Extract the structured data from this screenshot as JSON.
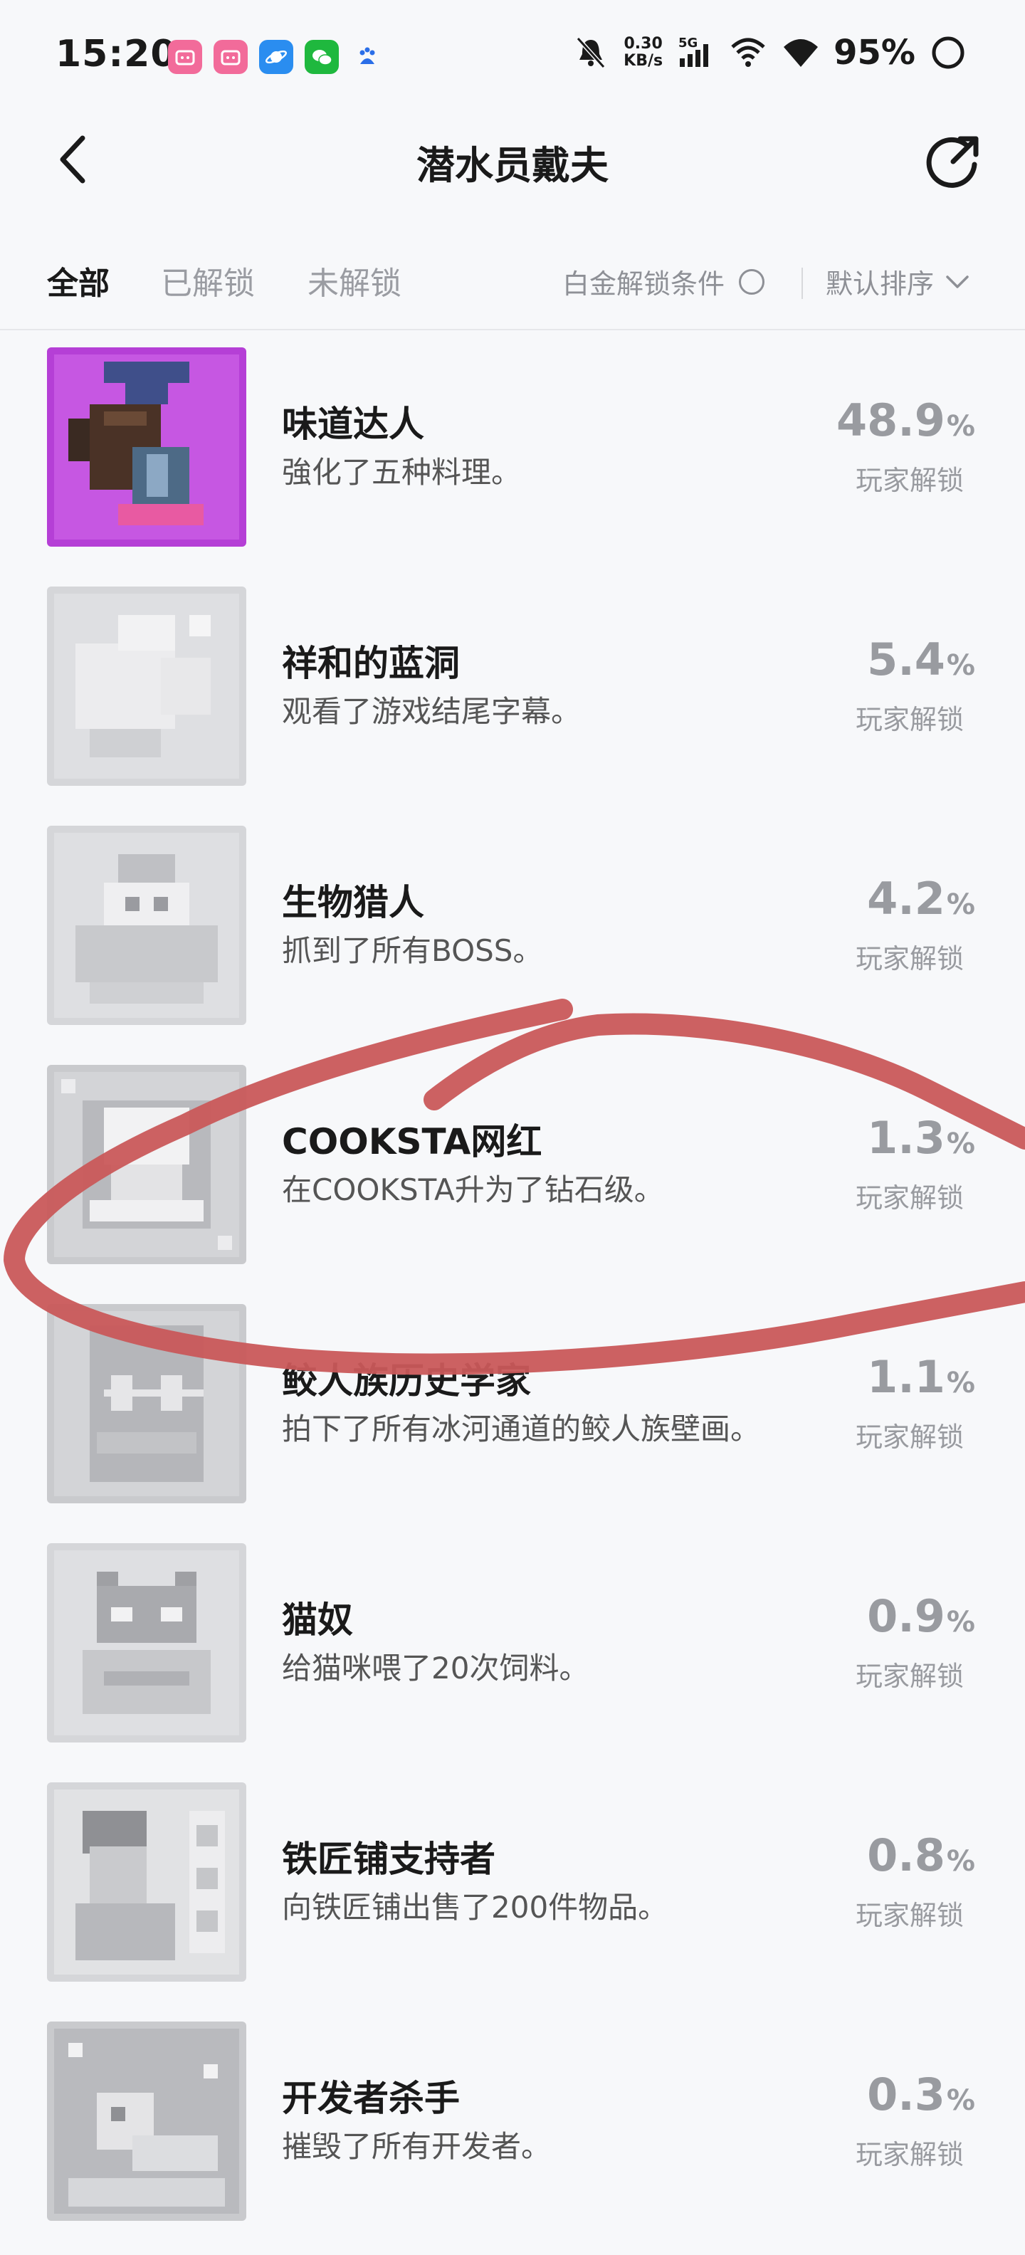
{
  "status": {
    "time": "15:20",
    "net_speed_value": "0.30",
    "net_speed_unit": "KB/s",
    "network": "5G",
    "battery": "95%"
  },
  "header": {
    "title": "潜水员戴夫"
  },
  "filters": {
    "tabs": [
      "全部",
      "已解锁",
      "未解锁"
    ],
    "active_tab": "全部",
    "platinum_label": "白金解锁条件",
    "sort_label": "默认排序"
  },
  "achievements": [
    {
      "name": "味道达人",
      "desc": "強化了五种料理。",
      "percent": "48.9",
      "unit": "%",
      "label": "玩家解锁",
      "unlocked": true
    },
    {
      "name": "祥和的蓝洞",
      "desc": "观看了游戏结尾字幕。",
      "percent": "5.4",
      "unit": "%",
      "label": "玩家解锁",
      "unlocked": false
    },
    {
      "name": "生物猎人",
      "desc": "抓到了所有BOSS。",
      "percent": "4.2",
      "unit": "%",
      "label": "玩家解锁",
      "unlocked": false
    },
    {
      "name": "COOKSTA网红",
      "desc": "在COOKSTA升为了钻石级。",
      "percent": "1.3",
      "unit": "%",
      "label": "玩家解锁",
      "unlocked": false
    },
    {
      "name": "鲛人族历史学家",
      "desc": "拍下了所有冰河通道的鲛人族壁画。",
      "percent": "1.1",
      "unit": "%",
      "label": "玩家解锁",
      "unlocked": false
    },
    {
      "name": "猫奴",
      "desc": "给猫咪喂了20次饲料。",
      "percent": "0.9",
      "unit": "%",
      "label": "玩家解锁",
      "unlocked": false
    },
    {
      "name": "铁匠铺支持者",
      "desc": "向铁匠铺出售了200件物品。",
      "percent": "0.8",
      "unit": "%",
      "label": "玩家解锁",
      "unlocked": false
    },
    {
      "name": "开发者杀手",
      "desc": "摧毁了所有开发者。",
      "percent": "0.3",
      "unit": "%",
      "label": "玩家解锁",
      "unlocked": false
    }
  ],
  "colors": {
    "accent_purple": "#b53fd6",
    "annotation_red": "#c9585a",
    "muted_text": "#999ba0"
  }
}
